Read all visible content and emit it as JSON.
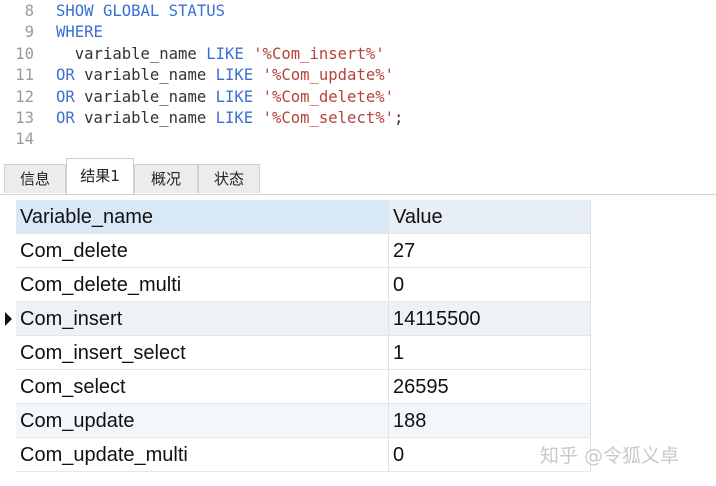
{
  "editor": {
    "lines": [
      {
        "num": "8",
        "parts": [
          {
            "t": "SHOW GLOBAL STATUS",
            "c": "kw"
          }
        ]
      },
      {
        "num": "9",
        "parts": [
          {
            "t": "WHERE",
            "c": "kw"
          }
        ]
      },
      {
        "num": "10",
        "parts": [
          {
            "t": "  variable_name ",
            "c": "txt"
          },
          {
            "t": "LIKE",
            "c": "kw"
          },
          {
            "t": " ",
            "c": "txt"
          },
          {
            "t": "'%Com_insert%'",
            "c": "str"
          }
        ]
      },
      {
        "num": "11",
        "parts": [
          {
            "t": "OR",
            "c": "kw"
          },
          {
            "t": " variable_name ",
            "c": "txt"
          },
          {
            "t": "LIKE",
            "c": "kw"
          },
          {
            "t": " ",
            "c": "txt"
          },
          {
            "t": "'%Com_update%'",
            "c": "str"
          }
        ]
      },
      {
        "num": "12",
        "parts": [
          {
            "t": "OR",
            "c": "kw"
          },
          {
            "t": " variable_name ",
            "c": "txt"
          },
          {
            "t": "LIKE",
            "c": "kw"
          },
          {
            "t": " ",
            "c": "txt"
          },
          {
            "t": "'%Com_delete%'",
            "c": "str"
          }
        ]
      },
      {
        "num": "13",
        "parts": [
          {
            "t": "OR",
            "c": "kw"
          },
          {
            "t": " variable_name ",
            "c": "txt"
          },
          {
            "t": "LIKE",
            "c": "kw"
          },
          {
            "t": " ",
            "c": "txt"
          },
          {
            "t": "'%Com_select%'",
            "c": "str"
          },
          {
            "t": ";",
            "c": "txt"
          }
        ]
      },
      {
        "num": "14",
        "parts": []
      }
    ]
  },
  "tabs": [
    {
      "label": "信息",
      "active": false
    },
    {
      "label": "结果1",
      "active": true
    },
    {
      "label": "概况",
      "active": false
    },
    {
      "label": "状态",
      "active": false
    }
  ],
  "grid": {
    "columns": [
      "Variable_name",
      "Value"
    ],
    "rows": [
      {
        "name": "Com_delete",
        "value": "27"
      },
      {
        "name": "Com_delete_multi",
        "value": "0"
      },
      {
        "name": "Com_insert",
        "value": "14115500"
      },
      {
        "name": "Com_insert_select",
        "value": "1"
      },
      {
        "name": "Com_select",
        "value": "26595"
      },
      {
        "name": "Com_update",
        "value": "188"
      },
      {
        "name": "Com_update_multi",
        "value": "0"
      }
    ],
    "current_row_index": 2
  },
  "watermark": "知乎 @令狐义卓",
  "colors": {
    "keyword": "#3b6fd4",
    "string": "#b5433b",
    "line_number": "#9a9a9a",
    "header_bg": "#e7eef6"
  }
}
